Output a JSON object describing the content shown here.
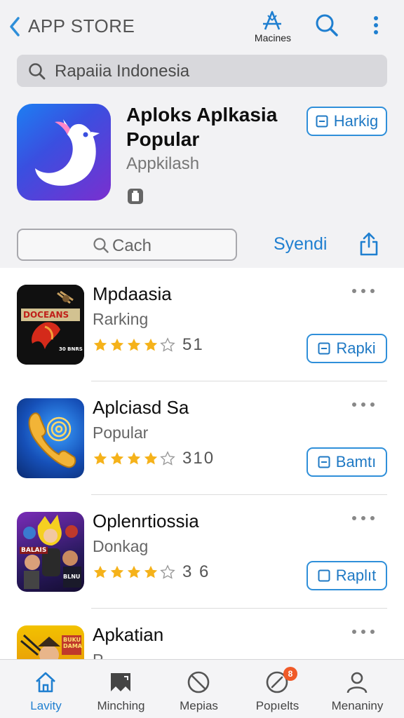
{
  "header": {
    "back_icon": "chevron-left-icon",
    "title": "APP STORE",
    "machines_label": "Macines",
    "accent_color": "#1f7fd0"
  },
  "search": {
    "placeholder": "Rapaiia Indonesia"
  },
  "featured": {
    "title_line1": "Aploks Aplkasia",
    "title_line2": "Popular",
    "subtitle": "Appkilash",
    "button_label": "Harkig",
    "icon": "white-bird-logo"
  },
  "filter": {
    "input_placeholder": "Cach",
    "link_label": "Syendi",
    "share_icon": "share-icon"
  },
  "apps": [
    {
      "name": "Mpdaasia",
      "category": "Rarking",
      "rating": 4,
      "count": "51",
      "button_label": "Rapki",
      "icon_text_top": "DOCEANS",
      "icon_text_bottom": "30 BNRS"
    },
    {
      "name": "Aplciasd Sa",
      "category": "Popular",
      "rating": 4,
      "count": "310",
      "button_label": "Bamtı",
      "icon": "golden-phone-fingerprint"
    },
    {
      "name": "Oplenrtiossia",
      "category": "Donkag",
      "rating": 4,
      "count": "3 6",
      "button_label": "Raplıt",
      "icon_text_left": "BALAIS",
      "icon_text_right": "BLNU"
    },
    {
      "name": "Apkatian",
      "category": "P...",
      "icon_text_right": "BUKU DAMA"
    }
  ],
  "nav": [
    {
      "label": "Lavity",
      "icon": "home-icon",
      "active": true
    },
    {
      "label": "Minching",
      "icon": "bookmark-icon",
      "active": false
    },
    {
      "label": "Mepias",
      "icon": "no-entry-icon",
      "active": false
    },
    {
      "label": "Popıelts",
      "icon": "compass-icon",
      "active": false,
      "badge": "8"
    },
    {
      "label": "Menaniny",
      "icon": "person-icon",
      "active": false
    }
  ]
}
